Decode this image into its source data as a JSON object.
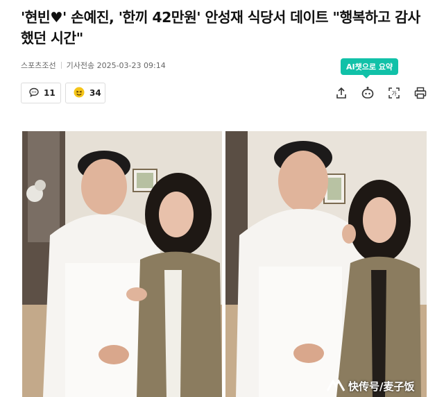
{
  "article": {
    "headline": "'현빈♥' 손예진, '한끼 42만원' 안성재 식당서 데이트 \"행복하고 감사했던 시간\"",
    "source": "스포츠조선",
    "timestamp": "기사전송 2025-03-23 09:14"
  },
  "ai_summary": {
    "label": "AI챗으로 요약"
  },
  "reactions": {
    "comments": {
      "icon": "comment-icon",
      "count": "11"
    },
    "likes": {
      "icon": "emoji-icon",
      "count": "34"
    }
  },
  "toolbar": {
    "icons": [
      "share-icon",
      "chatbot-icon",
      "translate-icon",
      "print-icon"
    ]
  },
  "watermark": {
    "text": "快传号/麦子饭"
  },
  "colors": {
    "accent": "#11c1a8",
    "text": "#111111",
    "meta": "#666666"
  }
}
